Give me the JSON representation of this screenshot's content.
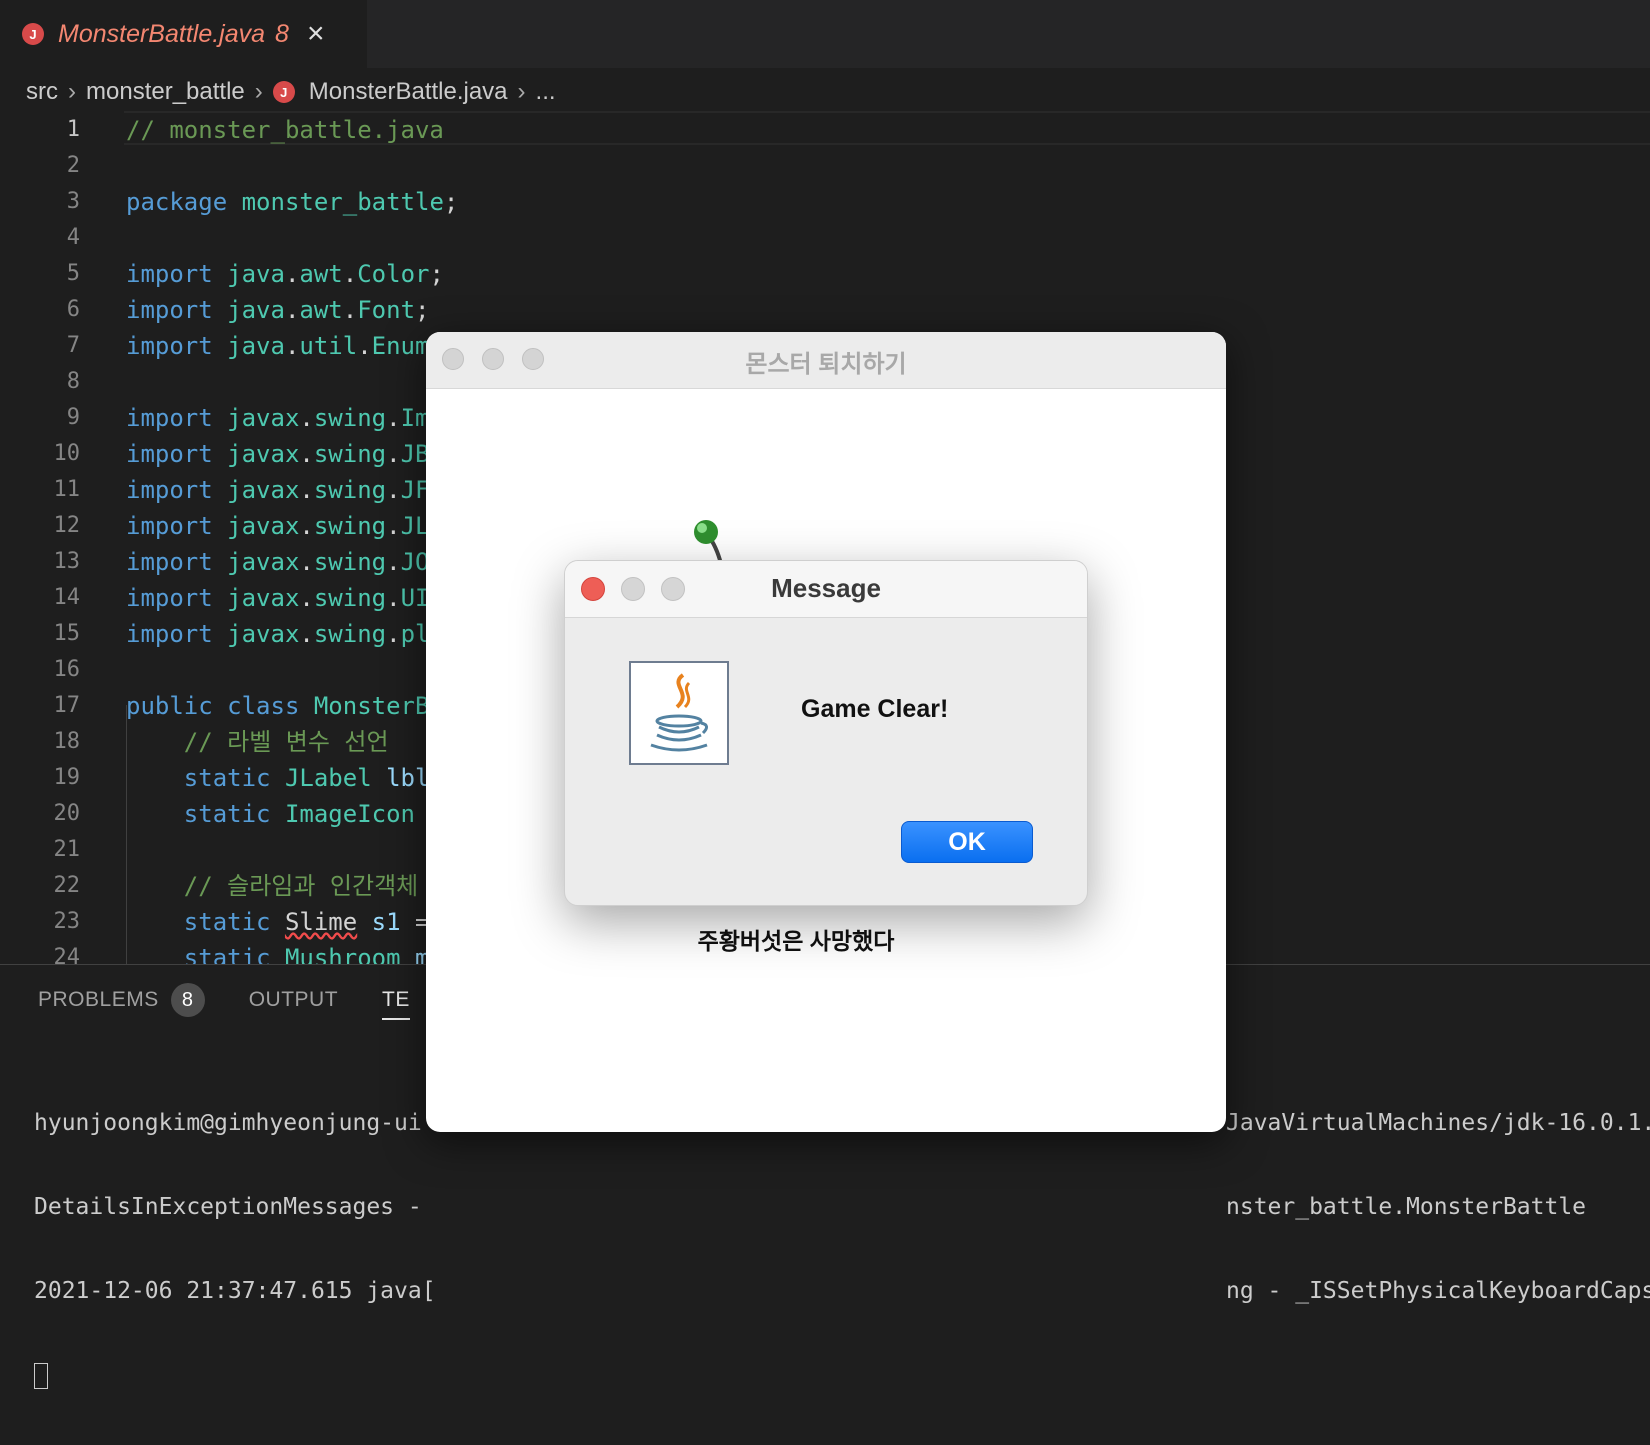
{
  "tab": {
    "badge": "J",
    "title": "MonsterBattle.java",
    "problem_count": "8",
    "close": "×"
  },
  "breadcrumb": {
    "items": [
      "src",
      "monster_battle",
      "MonsterBattle.java",
      "..."
    ],
    "separator": "›"
  },
  "editor": {
    "line_numbers": [
      "1",
      "2",
      "3",
      "4",
      "5",
      "6",
      "7",
      "8",
      "9",
      "10",
      "11",
      "12",
      "13",
      "14",
      "15",
      "16",
      "17",
      "18",
      "19",
      "20",
      "21",
      "22",
      "23",
      "24"
    ],
    "active_line": "1",
    "lines": [
      {
        "n": 1,
        "tokens": [
          [
            "cm",
            "// monster_battle.java"
          ]
        ]
      },
      {
        "n": 2,
        "tokens": []
      },
      {
        "n": 3,
        "tokens": [
          [
            "kw",
            "package"
          ],
          [
            "pl",
            " "
          ],
          [
            "ns",
            "monster_battle"
          ],
          [
            "pl",
            ";"
          ]
        ]
      },
      {
        "n": 4,
        "tokens": []
      },
      {
        "n": 5,
        "tokens": [
          [
            "kw",
            "import"
          ],
          [
            "pl",
            " "
          ],
          [
            "ns",
            "java"
          ],
          [
            "pl",
            "."
          ],
          [
            "ns",
            "awt"
          ],
          [
            "pl",
            "."
          ],
          [
            "ns",
            "Color"
          ],
          [
            "pl",
            ";"
          ]
        ]
      },
      {
        "n": 6,
        "tokens": [
          [
            "kw",
            "import"
          ],
          [
            "pl",
            " "
          ],
          [
            "ns",
            "java"
          ],
          [
            "pl",
            "."
          ],
          [
            "ns",
            "awt"
          ],
          [
            "pl",
            "."
          ],
          [
            "ns",
            "Font"
          ],
          [
            "pl",
            ";"
          ]
        ]
      },
      {
        "n": 7,
        "tokens": [
          [
            "kw",
            "import"
          ],
          [
            "pl",
            " "
          ],
          [
            "ns",
            "java"
          ],
          [
            "pl",
            "."
          ],
          [
            "ns",
            "util"
          ],
          [
            "pl",
            "."
          ],
          [
            "ns",
            "Enum"
          ]
        ]
      },
      {
        "n": 8,
        "tokens": []
      },
      {
        "n": 9,
        "tokens": [
          [
            "kw",
            "import"
          ],
          [
            "pl",
            " "
          ],
          [
            "ns",
            "javax"
          ],
          [
            "pl",
            "."
          ],
          [
            "ns",
            "swing"
          ],
          [
            "pl",
            "."
          ],
          [
            "ns",
            "Im"
          ]
        ]
      },
      {
        "n": 10,
        "tokens": [
          [
            "kw",
            "import"
          ],
          [
            "pl",
            " "
          ],
          [
            "ns",
            "javax"
          ],
          [
            "pl",
            "."
          ],
          [
            "ns",
            "swing"
          ],
          [
            "pl",
            "."
          ],
          [
            "ns",
            "JB"
          ]
        ]
      },
      {
        "n": 11,
        "tokens": [
          [
            "kw",
            "import"
          ],
          [
            "pl",
            " "
          ],
          [
            "ns",
            "javax"
          ],
          [
            "pl",
            "."
          ],
          [
            "ns",
            "swing"
          ],
          [
            "pl",
            "."
          ],
          [
            "ns",
            "JF"
          ]
        ]
      },
      {
        "n": 12,
        "tokens": [
          [
            "kw",
            "import"
          ],
          [
            "pl",
            " "
          ],
          [
            "ns",
            "javax"
          ],
          [
            "pl",
            "."
          ],
          [
            "ns",
            "swing"
          ],
          [
            "pl",
            "."
          ],
          [
            "ns",
            "JL"
          ]
        ]
      },
      {
        "n": 13,
        "tokens": [
          [
            "kw",
            "import"
          ],
          [
            "pl",
            " "
          ],
          [
            "ns",
            "javax"
          ],
          [
            "pl",
            "."
          ],
          [
            "ns",
            "swing"
          ],
          [
            "pl",
            "."
          ],
          [
            "ns",
            "JO"
          ]
        ]
      },
      {
        "n": 14,
        "tokens": [
          [
            "kw",
            "import"
          ],
          [
            "pl",
            " "
          ],
          [
            "ns",
            "javax"
          ],
          [
            "pl",
            "."
          ],
          [
            "ns",
            "swing"
          ],
          [
            "pl",
            "."
          ],
          [
            "ns",
            "UI"
          ]
        ]
      },
      {
        "n": 15,
        "tokens": [
          [
            "kw",
            "import"
          ],
          [
            "pl",
            " "
          ],
          [
            "ns",
            "javax"
          ],
          [
            "pl",
            "."
          ],
          [
            "ns",
            "swing"
          ],
          [
            "pl",
            "."
          ],
          [
            "ns",
            "pl"
          ]
        ]
      },
      {
        "n": 16,
        "tokens": []
      },
      {
        "n": 17,
        "tokens": [
          [
            "kw",
            "public"
          ],
          [
            "pl",
            " "
          ],
          [
            "kw",
            "class"
          ],
          [
            "pl",
            " "
          ],
          [
            "ns",
            "MonsterB"
          ]
        ]
      },
      {
        "n": 18,
        "tokens": [
          [
            "pl",
            "    "
          ],
          [
            "cm",
            "// 라벨 변수 선언"
          ]
        ]
      },
      {
        "n": 19,
        "tokens": [
          [
            "pl",
            "    "
          ],
          [
            "kw",
            "static"
          ],
          [
            "pl",
            " "
          ],
          [
            "ns",
            "JLabel"
          ],
          [
            "pl",
            " "
          ],
          [
            "vr",
            "lbl"
          ]
        ]
      },
      {
        "n": 20,
        "tokens": [
          [
            "pl",
            "    "
          ],
          [
            "kw",
            "static"
          ],
          [
            "pl",
            " "
          ],
          [
            "ns",
            "ImageIcon"
          ]
        ]
      },
      {
        "n": 21,
        "tokens": []
      },
      {
        "n": 22,
        "tokens": [
          [
            "pl",
            "    "
          ],
          [
            "cm",
            "// 슬라임과 인간객체 "
          ]
        ]
      },
      {
        "n": 23,
        "tokens": [
          [
            "pl",
            "    "
          ],
          [
            "kw",
            "static"
          ],
          [
            "pl",
            " "
          ],
          [
            "err",
            "Slime"
          ],
          [
            "pl",
            " "
          ],
          [
            "vr",
            "s1"
          ],
          [
            "pl",
            " ="
          ]
        ]
      },
      {
        "n": 24,
        "tokens": [
          [
            "pl",
            "    "
          ],
          [
            "kw",
            "static"
          ],
          [
            "pl",
            " "
          ],
          [
            "ns",
            "Mushroom"
          ],
          [
            "pl",
            " "
          ],
          [
            "vr",
            "m"
          ]
        ]
      }
    ]
  },
  "panel": {
    "tabs": [
      {
        "label": "PROBLEMS",
        "badge": "8"
      },
      {
        "label": "OUTPUT"
      },
      {
        "label": "TE"
      }
    ],
    "terminal_left": [
      "hyunjoongkim@gimhyeonjung-ui",
      "DetailsInExceptionMessages -",
      "2021-12-06 21:37:47.615 java["
    ],
    "terminal_right": [
      "JavaVirtualMachines/jdk-16.0.1.",
      "nster_battle.MonsterBattle",
      "ng - _ISSetPhysicalKeyboardCapsL"
    ]
  },
  "frame": {
    "title": "몬스터 퇴치하기",
    "status": "주황버섯은 사망했다"
  },
  "dialog": {
    "title": "Message",
    "message": "Game Clear!",
    "ok_label": "OK"
  },
  "colors": {
    "accent": "#0a6ff0",
    "error": "#f48771",
    "close_light": "#ee5e56"
  }
}
